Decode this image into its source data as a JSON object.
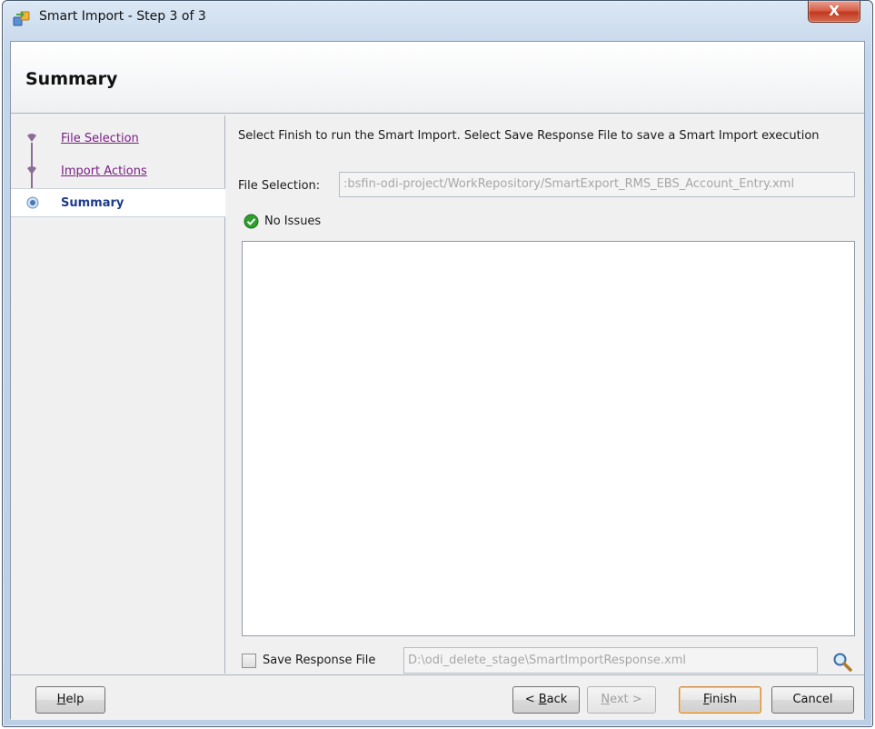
{
  "window": {
    "title": "Smart Import - Step 3 of 3",
    "close_label": "X"
  },
  "header": {
    "title": "Summary"
  },
  "nav": {
    "items": [
      {
        "label": "File Selection",
        "state": "visited"
      },
      {
        "label": "Import Actions",
        "state": "visited"
      },
      {
        "label": "Summary",
        "state": "current"
      }
    ]
  },
  "main": {
    "instructions": "Select Finish to run the Smart Import. Select Save Response File to save a Smart Import execution",
    "file_selection_label": "File Selection:",
    "file_selection_value": ":bsfin-odi-project/WorkRepository/SmartExport_RMS_EBS_Account_Entry.xml",
    "status_text": "No Issues",
    "save_response": {
      "checked": false,
      "label": "Save Response File",
      "path": "D:\\odi_delete_stage\\SmartImportResponse.xml"
    }
  },
  "footer": {
    "help": {
      "mnemonic": "H",
      "rest": "elp"
    },
    "back": {
      "prefix": "< ",
      "mnemonic": "B",
      "rest": "ack"
    },
    "next": {
      "mnemonic": "N",
      "rest": "ext >"
    },
    "finish": {
      "mnemonic": "F",
      "rest": "inish"
    },
    "cancel": "Cancel"
  },
  "colors": {
    "link_visited": "#7a1f85",
    "current_step": "#1e3c8a",
    "status_ok": "#2e9e2e",
    "close_button": "#c0391f"
  },
  "icons": {
    "app": "smart-import-app-icon",
    "status": "check-circle-icon",
    "browse": "magnifier-icon"
  }
}
